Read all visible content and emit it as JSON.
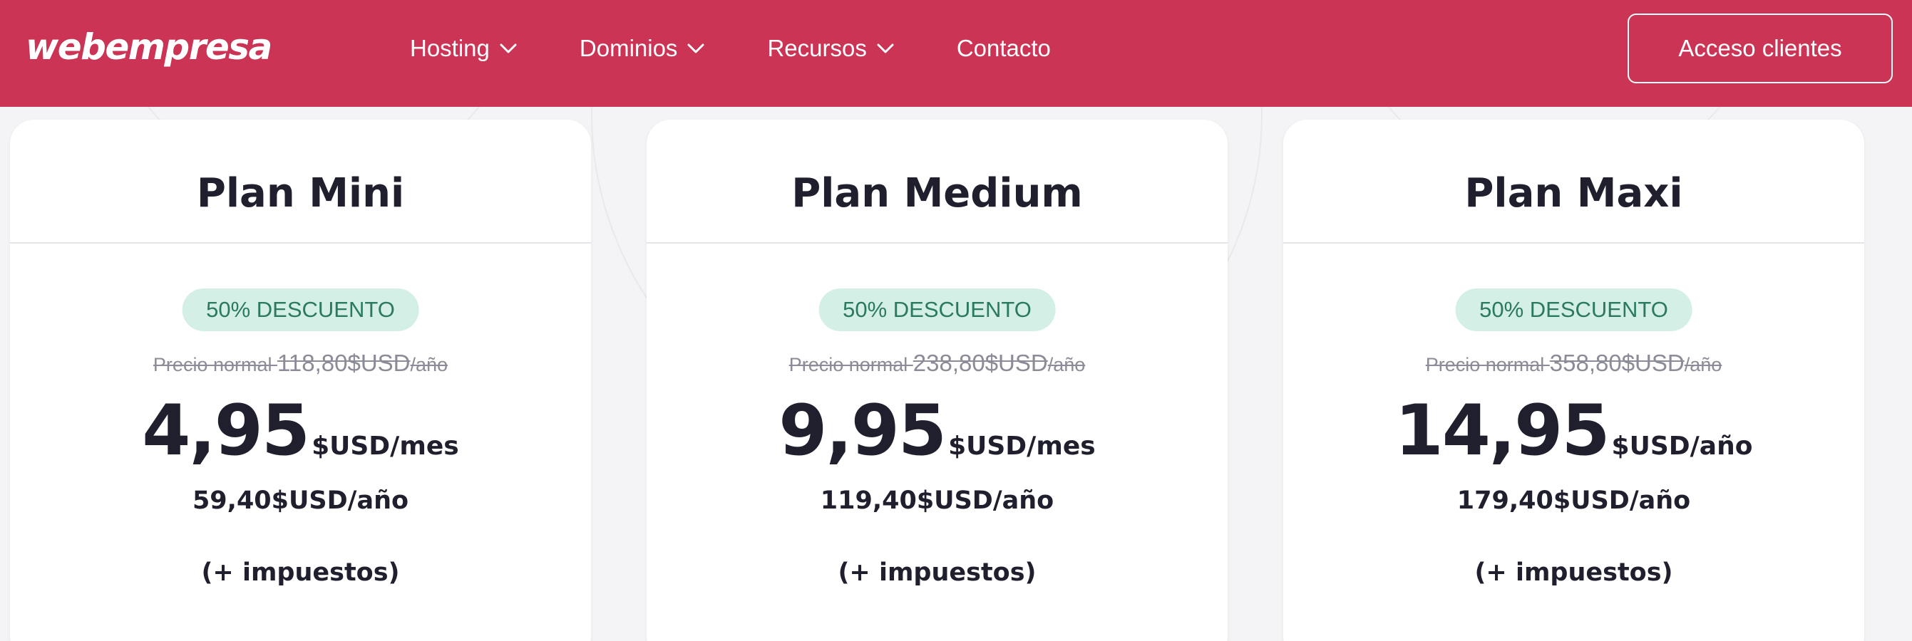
{
  "header": {
    "logo": "webempresa",
    "nav": [
      {
        "label": "Hosting",
        "has_dropdown": true
      },
      {
        "label": "Dominios",
        "has_dropdown": true
      },
      {
        "label": "Recursos",
        "has_dropdown": true
      },
      {
        "label": "Contacto",
        "has_dropdown": false
      }
    ],
    "cta_label": "Acceso clientes"
  },
  "plans": [
    {
      "title": "Plan Mini",
      "badge": "50% DESCUENTO",
      "normal_prefix": "Precio normal ",
      "normal_amount": "118,80$USD",
      "normal_suffix": "/año",
      "price": "4,95",
      "price_unit": "$USD/mes",
      "annual": "59,40$USD/año",
      "taxes": "(+ impuestos)"
    },
    {
      "title": "Plan Medium",
      "badge": "50% DESCUENTO",
      "normal_prefix": "Precio normal ",
      "normal_amount": "238,80$USD",
      "normal_suffix": "/año",
      "price": "9,95",
      "price_unit": "$USD/mes",
      "annual": "119,40$USD/año",
      "taxes": "(+ impuestos)"
    },
    {
      "title": "Plan Maxi",
      "badge": "50% DESCUENTO",
      "normal_prefix": "Precio normal ",
      "normal_amount": "358,80$USD",
      "normal_suffix": "/año",
      "price": "14,95",
      "price_unit": "$USD/año",
      "annual": "179,40$USD/año",
      "taxes": "(+ impuestos)"
    }
  ],
  "colors": {
    "brand": "#cc3455",
    "badge_bg": "#d4efe6",
    "badge_text": "#2c7a5e",
    "text_dark": "#1f1f2e",
    "text_muted": "#8c8c98"
  },
  "icons": {
    "dropdown": "chevron-down-icon"
  }
}
